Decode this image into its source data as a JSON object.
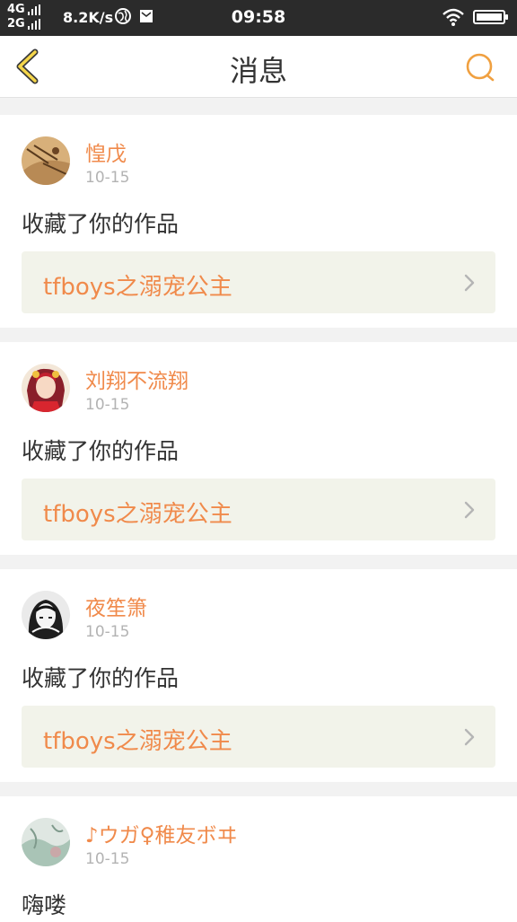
{
  "status_bar": {
    "network_top": "4G",
    "network_bottom": "2G",
    "speed": "8.2K/s",
    "time": "09:58",
    "icons": [
      "signal-icon",
      "earth-icon",
      "mail-icon",
      "wifi-icon",
      "battery-icon"
    ]
  },
  "header": {
    "title": "消息",
    "back_icon": "chevron-left-icon",
    "search_icon": "search-icon",
    "accent_color": "#f0a040"
  },
  "messages": [
    {
      "user": "惶戊",
      "date": "10-15",
      "action": "收藏了你的作品",
      "work_title": "tfboys之溺宠公主"
    },
    {
      "user": "刘翔不流翔",
      "date": "10-15",
      "action": "收藏了你的作品",
      "work_title": "tfboys之溺宠公主"
    },
    {
      "user": "夜笙箫",
      "date": "10-15",
      "action": "收藏了你的作品",
      "work_title": "tfboys之溺宠公主"
    },
    {
      "user": "♪ウガ♀稚友ボヰ",
      "date": "10-15",
      "action": "嗨喽"
    }
  ],
  "colors": {
    "name": "#f08a4b",
    "date": "#b3b3b3",
    "work_bg": "#f2f3ea",
    "page_bg": "#f2f2f2"
  }
}
